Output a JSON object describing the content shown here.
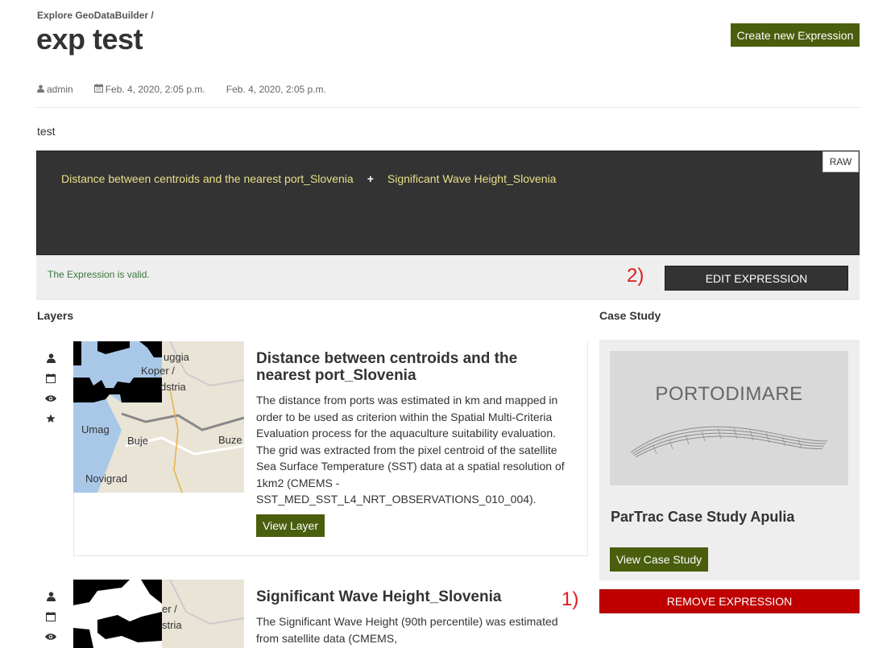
{
  "breadcrumb": "Explore GeoDataBuilder /",
  "page_title": "exp test",
  "header": {
    "create_label": "Create new Expression"
  },
  "meta": {
    "author": "admin",
    "created": "Feb. 4, 2020, 2:05 p.m.",
    "updated": "Feb. 4, 2020, 2:05 p.m."
  },
  "description": "test",
  "expression": {
    "term1": "Distance between centroids and the nearest port_Slovenia",
    "operator": "+",
    "term2": "Significant Wave Height_Slovenia",
    "raw_label": "RAW"
  },
  "validation": {
    "message": "The Expression is valid.",
    "edit_label": "EDIT EXPRESSION",
    "annotation": "2)"
  },
  "layers_heading": "Layers",
  "case_heading": "Case Study",
  "layers": [
    {
      "title": "Distance between centroids and the nearest port_Slovenia",
      "description": "The distance from ports was estimated in km and mapped in order to be used as criterion within the Spatial Multi-Criteria Evaluation process for the aquaculture suitability evaluation. The grid was extracted from the pixel centroid of the satellite Sea Surface Temperature (SST) data at a spatial resolution of 1km2 (CMEMS - SST_MED_SST_L4_NRT_OBSERVATIONS_010_004).",
      "button_label": "View Layer",
      "map_labels": [
        "uggia",
        "Koper /",
        "dstria",
        "Umag",
        "Buje",
        "Buze",
        "Novigrad"
      ]
    },
    {
      "title": "Significant Wave Height_Slovenia",
      "description": "The Significant Wave Height (90th percentile) was estimated from satellite data (CMEMS,",
      "map_labels": [
        "er /",
        "stria"
      ]
    }
  ],
  "case_study": {
    "logo_text": "PORTODIMARE",
    "title": "ParTrac Case Study Apulia",
    "button_label": "View Case Study"
  },
  "remove": {
    "label": "REMOVE EXPRESSION",
    "annotation": "1)"
  },
  "colors": {
    "primary_green": "#4a5e0e",
    "danger_red": "#c00000",
    "expr_bg": "#333333",
    "expr_text": "#e8e08a",
    "valid_green": "#3c763d"
  },
  "icons": [
    "user-icon",
    "calendar-icon",
    "eye-icon",
    "star-icon"
  ]
}
